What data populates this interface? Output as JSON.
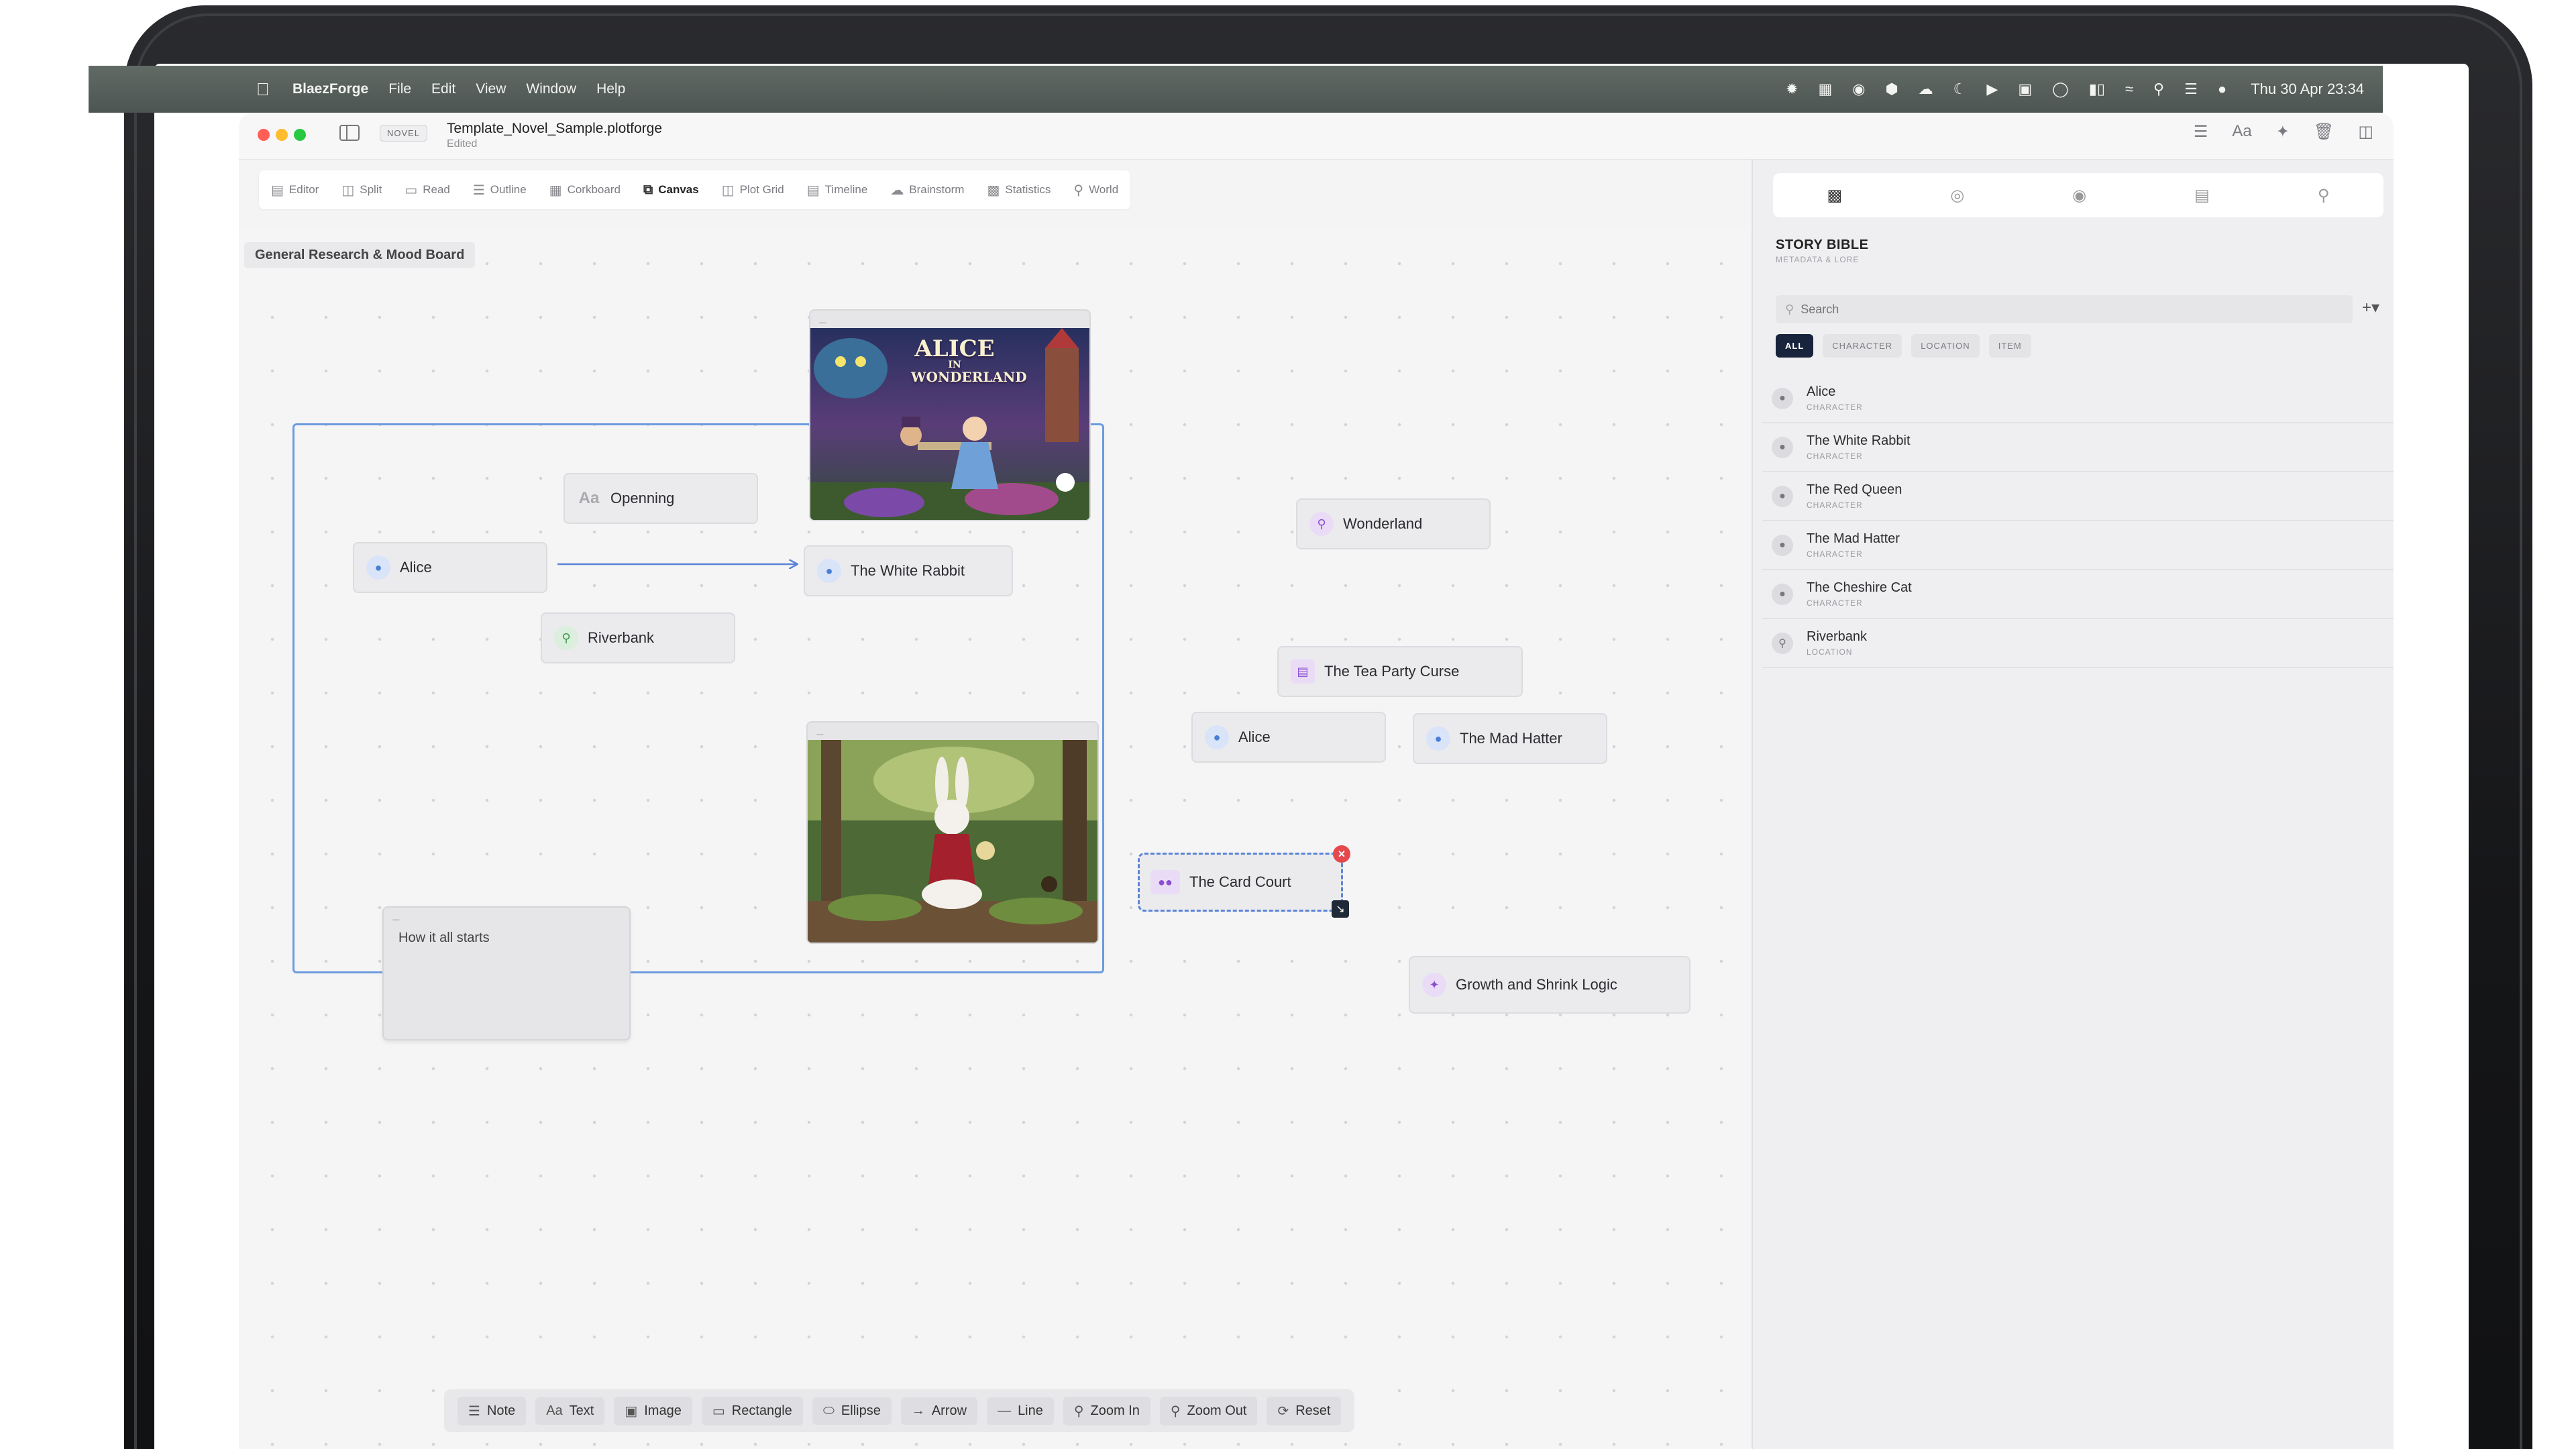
{
  "menubar": {
    "app_name": "BlaezForge",
    "items": [
      "File",
      "Edit",
      "View",
      "Window",
      "Help"
    ],
    "clock": "Thu 30 Apr  23:34"
  },
  "window": {
    "badge": "NOVEL",
    "title": "Template_Novel_Sample.plotforge",
    "status": "Edited"
  },
  "toolbar": {
    "tabs": [
      {
        "label": "Editor",
        "icon": "editor-icon"
      },
      {
        "label": "Split",
        "icon": "split-icon"
      },
      {
        "label": "Read",
        "icon": "read-icon"
      },
      {
        "label": "Outline",
        "icon": "outline-icon"
      },
      {
        "label": "Corkboard",
        "icon": "corkboard-icon"
      },
      {
        "label": "Canvas",
        "icon": "canvas-icon",
        "active": true
      },
      {
        "label": "Plot Grid",
        "icon": "plot-grid-icon"
      },
      {
        "label": "Timeline",
        "icon": "timeline-icon"
      },
      {
        "label": "Brainstorm",
        "icon": "brainstorm-icon"
      },
      {
        "label": "Statistics",
        "icon": "statistics-icon"
      },
      {
        "label": "World",
        "icon": "world-icon"
      }
    ]
  },
  "canvas": {
    "board_label": "General Research & Mood Board",
    "nodes": {
      "openning": "Openning",
      "alice": "Alice",
      "white_rabbit": "The White Rabbit",
      "riverbank": "Riverbank",
      "wonderland": "Wonderland",
      "tea_party": "The Tea Party Curse",
      "alice_2": "Alice",
      "mad_hatter": "The Mad Hatter",
      "card_court": "The Card Court",
      "growth_logic": "Growth and Shrink Logic"
    },
    "note": "How it all starts",
    "poster_title_line1": "ALICE",
    "poster_title_line2": "IN",
    "poster_title_line3": "WONDERLAND"
  },
  "bottom_toolbar": {
    "tools": [
      {
        "label": "Note",
        "icon": "note-icon"
      },
      {
        "label": "Text",
        "icon": "text-icon"
      },
      {
        "label": "Image",
        "icon": "image-icon"
      },
      {
        "label": "Rectangle",
        "icon": "rectangle-icon"
      },
      {
        "label": "Ellipse",
        "icon": "ellipse-icon"
      },
      {
        "label": "Arrow",
        "icon": "arrow-icon"
      },
      {
        "label": "Line",
        "icon": "line-icon"
      },
      {
        "label": "Zoom In",
        "icon": "zoom-in-icon"
      },
      {
        "label": "Zoom Out",
        "icon": "zoom-out-icon"
      },
      {
        "label": "Reset",
        "icon": "reset-icon"
      }
    ]
  },
  "panel": {
    "title": "STORY BIBLE",
    "subtitle": "METADATA & LORE",
    "search_placeholder": "Search",
    "filters": [
      "ALL",
      "CHARACTER",
      "LOCATION",
      "ITEM"
    ],
    "entries": [
      {
        "name": "Alice",
        "type": "CHARACTER"
      },
      {
        "name": "The White Rabbit",
        "type": "CHARACTER"
      },
      {
        "name": "The Red Queen",
        "type": "CHARACTER"
      },
      {
        "name": "The Mad Hatter",
        "type": "CHARACTER"
      },
      {
        "name": "The Cheshire Cat",
        "type": "CHARACTER"
      },
      {
        "name": "Riverbank",
        "type": "LOCATION"
      }
    ]
  },
  "colors": {
    "accent_blue": "#6c9be0",
    "selection": "#5b84d8",
    "delete": "#e5484d",
    "active_chip": "#18243c"
  }
}
